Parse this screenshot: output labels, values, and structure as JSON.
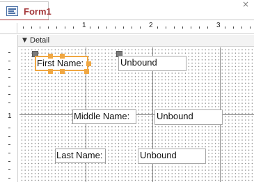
{
  "tab": {
    "title": "Form1",
    "icon": "form-icon"
  },
  "ruler": {
    "h_numbers": [
      "1",
      "2",
      "3"
    ],
    "v_numbers": [
      "1"
    ]
  },
  "section": {
    "label": "Detail",
    "icon": "collapse-arrow-icon"
  },
  "controls": {
    "first_name": {
      "label": "First Name:",
      "value": "Unbound"
    },
    "middle_name": {
      "label": "Middle Name:",
      "value": "Unbound"
    },
    "last_name": {
      "label": "Last Name:",
      "value": "Unbound"
    }
  },
  "colors": {
    "tab_accent": "#a4373a",
    "selection": "#f0a742",
    "grid_line": "#8a8a8a"
  }
}
